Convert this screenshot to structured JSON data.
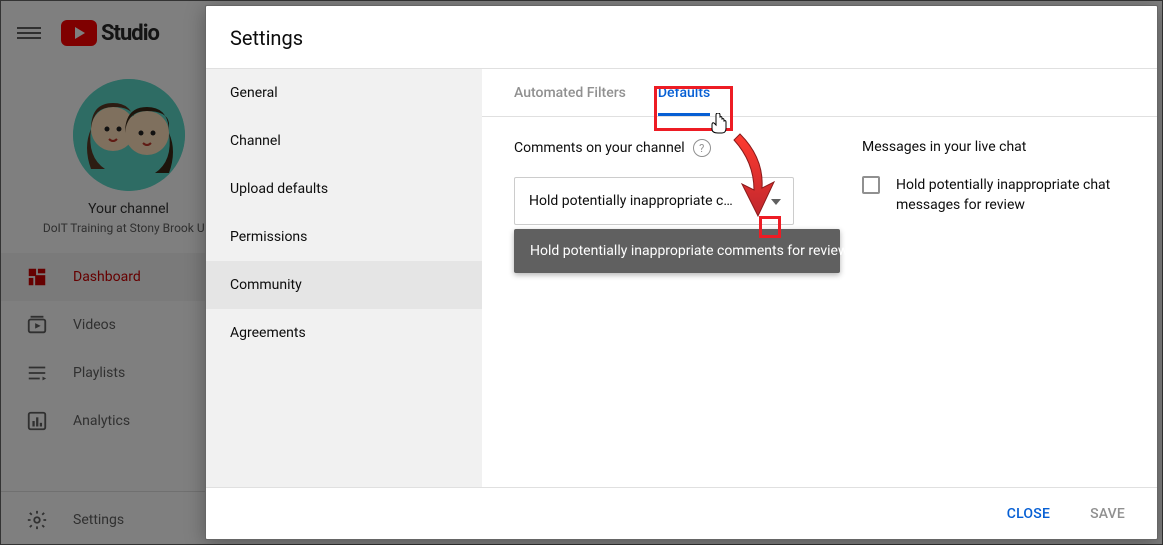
{
  "studio": {
    "brand": "Studio",
    "your_channel_label": "Your channel",
    "channel_name": "DoIT Training at Stony Brook Uni",
    "nav": [
      {
        "label": "Dashboard",
        "icon": "dashboard"
      },
      {
        "label": "Videos",
        "icon": "videos"
      },
      {
        "label": "Playlists",
        "icon": "playlists"
      },
      {
        "label": "Analytics",
        "icon": "analytics"
      }
    ],
    "settings_label": "Settings"
  },
  "modal": {
    "title": "Settings",
    "left_items": [
      "General",
      "Channel",
      "Upload defaults",
      "Permissions",
      "Community",
      "Agreements"
    ],
    "active_left_index": 4,
    "subtabs": [
      "Automated Filters",
      "Defaults"
    ],
    "active_subtab_index": 1,
    "comments_heading": "Comments on your channel",
    "comments_select_value": "Hold potentially inappropriate c…",
    "comments_dropdown_option": "Hold potentially inappropriate comments for review",
    "livechat_heading": "Messages in your live chat",
    "livechat_checkbox_label": "Hold potentially inappropriate chat messages for review",
    "close_label": "CLOSE",
    "save_label": "SAVE"
  }
}
